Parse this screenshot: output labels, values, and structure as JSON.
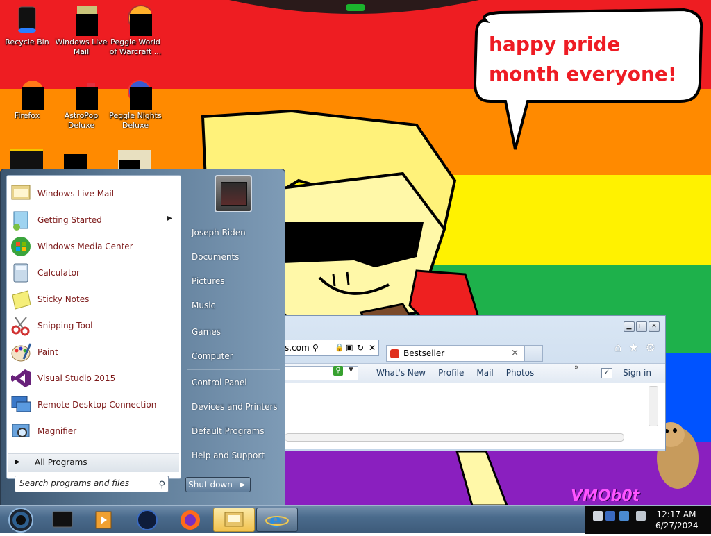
{
  "wallpaper": {
    "speech_bubble_text": "happy pride month everyone!",
    "watermark_text": "VMOb0t",
    "stripe_colors": [
      "#ee1d22",
      "#ff8a00",
      "#fff200",
      "#1eb14b",
      "#0053ff",
      "#8a1fbf"
    ]
  },
  "desktop_icons": [
    {
      "label": "Recycle Bin",
      "icon": "recycle-bin-icon"
    },
    {
      "label": "Windows Live Mail",
      "icon": "mail-icon"
    },
    {
      "label": "Peggle World of Warcraft ...",
      "icon": "peggle-icon"
    },
    {
      "label": "Firefox",
      "icon": "firefox-icon"
    },
    {
      "label": "AstroPop Deluxe",
      "icon": "astropop-icon"
    },
    {
      "label": "Peggle Nights Deluxe",
      "icon": "peggle-nights-icon"
    }
  ],
  "ie_window": {
    "address_text": "s.com",
    "tab_label": "Bestseller",
    "tab_close": "×",
    "links": [
      "What's New",
      "Profile",
      "Mail",
      "Photos"
    ],
    "more": "»",
    "sign_in": "Sign in"
  },
  "start_menu": {
    "programs": [
      {
        "label": "Windows Live Mail",
        "icon": "mail-icon"
      },
      {
        "label": "Getting Started",
        "icon": "getting-started-icon",
        "has_submenu": true
      },
      {
        "label": "Windows Media Center",
        "icon": "media-center-icon"
      },
      {
        "label": "Calculator",
        "icon": "calculator-icon"
      },
      {
        "label": "Sticky Notes",
        "icon": "sticky-notes-icon"
      },
      {
        "label": "Snipping Tool",
        "icon": "scissors-icon"
      },
      {
        "label": "Paint",
        "icon": "paint-palette-icon"
      },
      {
        "label": "Visual Studio 2015",
        "icon": "visual-studio-icon"
      },
      {
        "label": "Remote Desktop Connection",
        "icon": "remote-desktop-icon"
      },
      {
        "label": "Magnifier",
        "icon": "magnifier-icon"
      }
    ],
    "all_programs": "All Programs",
    "search_placeholder": "Search programs and files",
    "right_links": [
      "Joseph Biden",
      "Documents",
      "Pictures",
      "Music",
      "Games",
      "Computer",
      "Control Panel",
      "Devices and Printers",
      "Default Programs",
      "Help and Support"
    ],
    "shutdown_label": "Shut down"
  },
  "taskbar": {
    "pinned": [
      "media-player-icon",
      "media-player-legacy-icon",
      "globe-icon",
      "firefox-icon",
      "explorer-folder-icon",
      "internet-explorer-icon"
    ],
    "clock_time": "12:17 AM",
    "clock_date": "6/27/2024"
  }
}
